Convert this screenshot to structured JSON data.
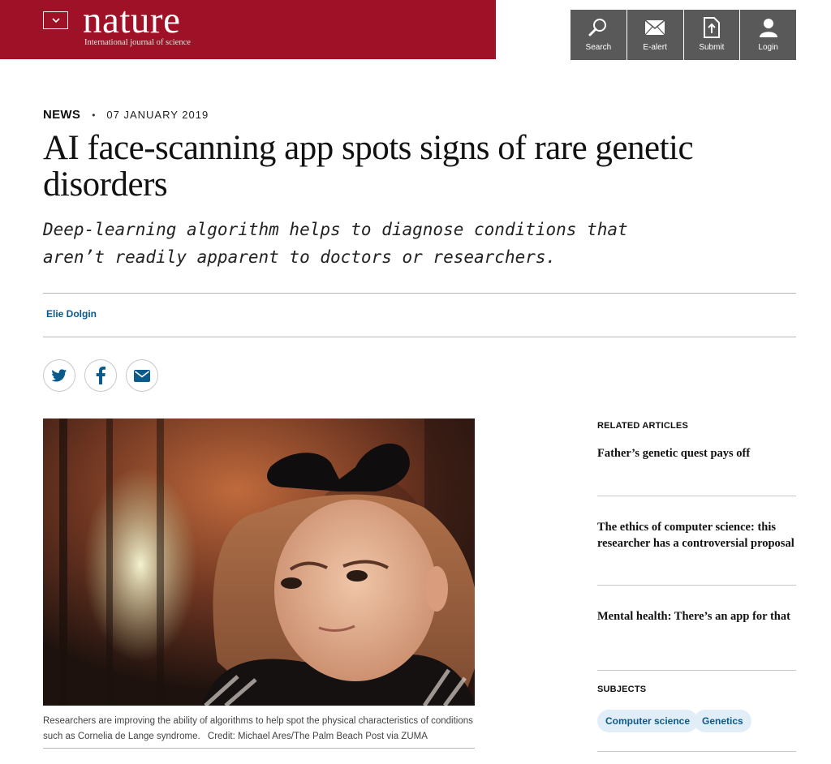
{
  "header": {
    "logo": "nature",
    "tagline": "International journal of science",
    "brand_color": "#9e1126",
    "tools": [
      {
        "label": "Search",
        "icon": "search-icon"
      },
      {
        "label": "E-alert",
        "icon": "mail-icon"
      },
      {
        "label": "Submit",
        "icon": "upload-icon"
      },
      {
        "label": "Login",
        "icon": "user-icon"
      }
    ]
  },
  "article": {
    "type": "NEWS",
    "date": "07 JANUARY 2019",
    "title": "AI face-scanning app spots signs of rare genetic disorders",
    "standfirst": "Deep-learning algorithm helps to diagnose conditions that aren’t readily apparent to doctors or researchers.",
    "author": "Elie Dolgin",
    "share": [
      {
        "icon": "twitter-icon"
      },
      {
        "icon": "facebook-icon"
      },
      {
        "icon": "email-icon"
      }
    ],
    "caption": "Researchers are improving the ability of algorithms to help spot the physical characteristics of conditions such as Cornelia de Lange syndrome.",
    "credit": "Credit: Michael Ares/The Palm Beach Post via ZUMA"
  },
  "sidebar": {
    "related_heading": "RELATED ARTICLES",
    "related": [
      "Father’s genetic quest pays off",
      "The ethics of computer science: this researcher has a controversial proposal",
      "Mental health: There’s an app for that"
    ],
    "subjects_heading": "SUBJECTS",
    "subjects": [
      "Computer science",
      "Genetics"
    ]
  }
}
